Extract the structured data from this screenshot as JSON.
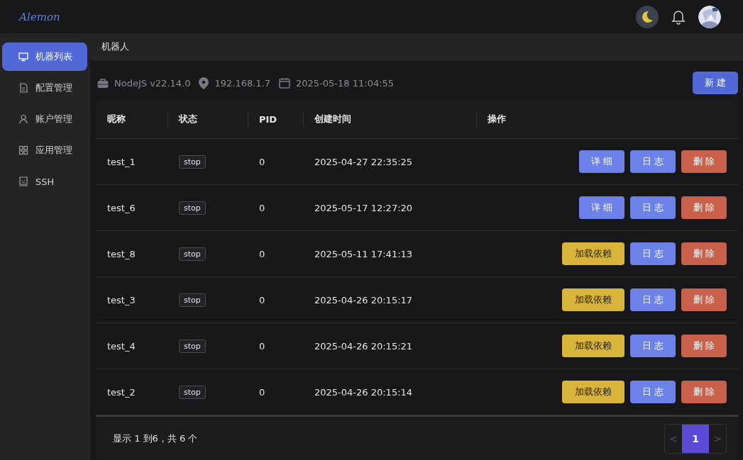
{
  "logo": "Alemon",
  "sidebar": {
    "items": [
      {
        "label": "机器列表",
        "kind": "monitor",
        "selected": true
      },
      {
        "label": "配置管理",
        "kind": "file",
        "selected": false
      },
      {
        "label": "账户管理",
        "kind": "user",
        "selected": false
      },
      {
        "label": "应用管理",
        "kind": "apps",
        "selected": false
      },
      {
        "label": "SSH",
        "kind": "terminal",
        "selected": false
      }
    ]
  },
  "breadcrumb": "机器人",
  "info": {
    "node": "NodeJS v22.14.0",
    "ip": "192.168.1.7",
    "date": "2025-05-18 11:04:55"
  },
  "new_button": "新 建",
  "table": {
    "columns": [
      "昵称",
      "状态",
      "PID",
      "创建时间",
      "操作"
    ],
    "rows": [
      {
        "name": "test_1",
        "status": "stop",
        "pid": "0",
        "created": "2025-04-27 22:35:25",
        "actions": [
          {
            "label": "详 细",
            "kind": "detail"
          },
          {
            "label": "日 志",
            "kind": "log"
          },
          {
            "label": "删 除",
            "kind": "delete"
          }
        ]
      },
      {
        "name": "test_6",
        "status": "stop",
        "pid": "0",
        "created": "2025-05-17 12:27:20",
        "actions": [
          {
            "label": "详 细",
            "kind": "detail"
          },
          {
            "label": "日 志",
            "kind": "log"
          },
          {
            "label": "删 除",
            "kind": "delete"
          }
        ]
      },
      {
        "name": "test_8",
        "status": "stop",
        "pid": "0",
        "created": "2025-05-11 17:41:13",
        "actions": [
          {
            "label": "加载依赖",
            "kind": "deps"
          },
          {
            "label": "日 志",
            "kind": "log"
          },
          {
            "label": "删 除",
            "kind": "delete"
          }
        ]
      },
      {
        "name": "test_3",
        "status": "stop",
        "pid": "0",
        "created": "2025-04-26 20:15:17",
        "actions": [
          {
            "label": "加载依赖",
            "kind": "deps"
          },
          {
            "label": "日 志",
            "kind": "log"
          },
          {
            "label": "删 除",
            "kind": "delete"
          }
        ]
      },
      {
        "name": "test_4",
        "status": "stop",
        "pid": "0",
        "created": "2025-04-26 20:15:21",
        "actions": [
          {
            "label": "加载依赖",
            "kind": "deps"
          },
          {
            "label": "日 志",
            "kind": "log"
          },
          {
            "label": "删 除",
            "kind": "delete"
          }
        ]
      },
      {
        "name": "test_2",
        "status": "stop",
        "pid": "0",
        "created": "2025-04-26 20:15:14",
        "actions": [
          {
            "label": "加载依赖",
            "kind": "deps"
          },
          {
            "label": "日 志",
            "kind": "log"
          },
          {
            "label": "删 除",
            "kind": "delete"
          }
        ]
      }
    ]
  },
  "footer": {
    "summary": "显示 1 到6，共 6 个",
    "pagination": {
      "prev": "<",
      "next": ">",
      "pages": [
        {
          "label": "1",
          "selected": true
        }
      ]
    }
  }
}
